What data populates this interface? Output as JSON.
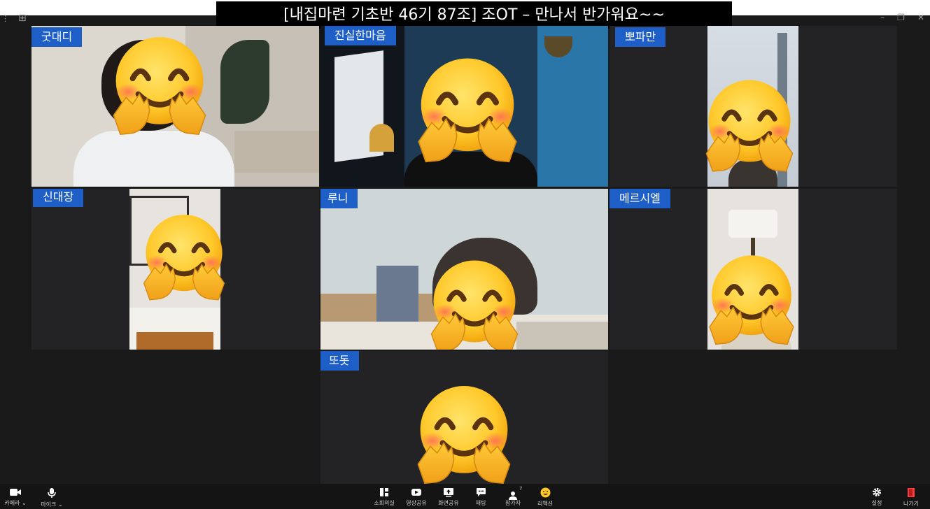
{
  "meeting": {
    "title": "[내집마련 기초반 46기 87조] 조OT – 만나서 반가워요~~"
  },
  "participants": [
    {
      "name": "굿대디",
      "active": true
    },
    {
      "name": "진실한마음"
    },
    {
      "name": "뽀파만"
    },
    {
      "name": "신대장"
    },
    {
      "name": "루니"
    },
    {
      "name": "메르시엘"
    },
    {
      "name": "또돗"
    }
  ],
  "toolbar": {
    "camera_label": "카메라 ⌄",
    "mic_label": "마이크 ⌄",
    "breakout_label": "소회의실",
    "video_share_label": "영상공유",
    "screen_share_label": "화면공유",
    "chat_label": "채팅",
    "participants_label": "참가자",
    "participants_count": "7",
    "reaction_label": "리액션",
    "settings_label": "설정",
    "leave_label": "나가기"
  },
  "colors": {
    "name_badge": "#1d5fc6",
    "active_border": "#2bd6a5",
    "tile_bg": "#232326",
    "toolbar_bg": "#141414"
  }
}
